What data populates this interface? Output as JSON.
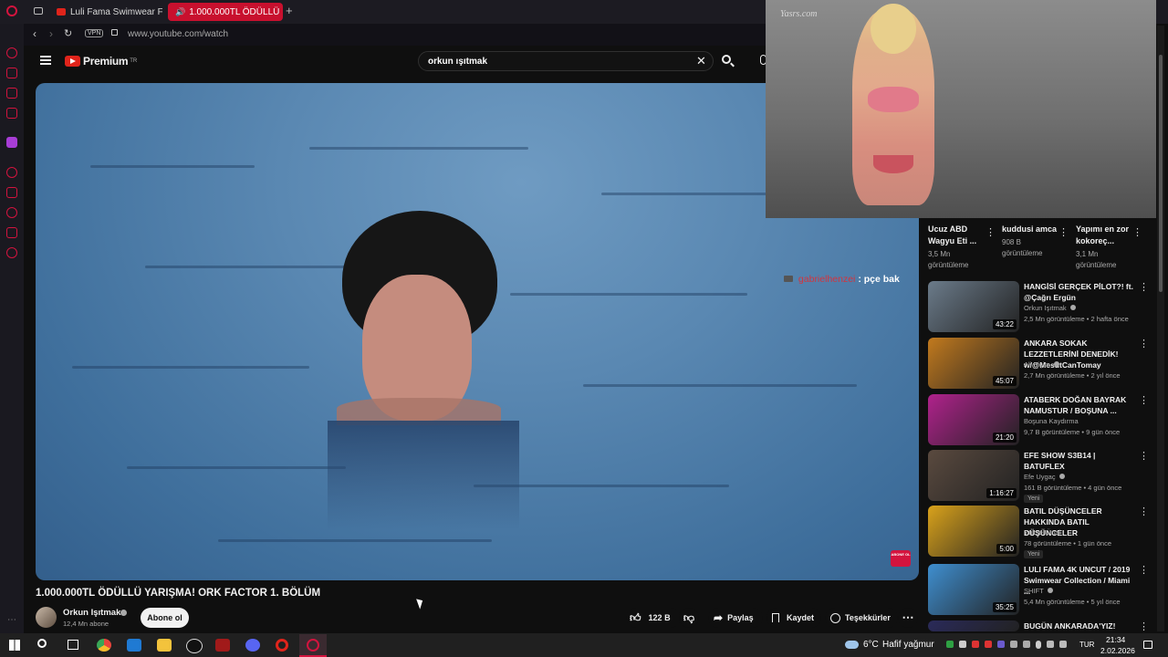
{
  "browser": {
    "tabs": [
      {
        "label": "Luli Fama Swimwear Fash",
        "active": false
      },
      {
        "label": "1.000.000TL ÖDÜLLÜ",
        "active": true
      }
    ],
    "new_tab": "+",
    "address": "www.youtube.com/watch",
    "vpn_label": "VPN"
  },
  "youtube": {
    "brand": "Premium",
    "brand_sup": "TR",
    "search_query": "orkun ışıtmak",
    "video_title": "1.000.000TL ÖDÜLLÜ YARIŞMA! ORK FACTOR 1. BÖLÜM",
    "channel_name": "Orkun Işıtmak",
    "subscribers": "12,4 Mn abone",
    "subscribe_label": "Abone ol",
    "likes": "122 B",
    "share_label": "Paylaş",
    "save_label": "Kaydet",
    "thanks_label": "Teşekkürler",
    "chat_user": "gabrielhenzei",
    "chat_message": ": pçe bak",
    "watermark_label": "ABONE OL",
    "pip_watermark": "Yasrs.com"
  },
  "shorts_row": [
    {
      "title": "Ucuz ABD Wagyu Eti ...",
      "views": "3,5 Mn",
      "views_label": "görüntüleme"
    },
    {
      "title": "kuddusi amca",
      "views": "908 B",
      "views_label": "görüntüleme"
    },
    {
      "title": "Yapımı en zor kokoreç...",
      "views": "3,1 Mn",
      "views_label": "görüntüleme"
    }
  ],
  "related": [
    {
      "title": "HANGİSİ GERÇEK PİLOT?! ft. @Çağrı Ergün",
      "channel": "Orkun Işıtmak",
      "verified": true,
      "meta": "2,5 Mn görüntüleme • 2 hafta önce",
      "duration": "43:22",
      "badge": "",
      "thumb_color": "#6b7b8a"
    },
    {
      "title": "ANKARA SOKAK LEZZETLERİNİ DENEDİK! w/@MesutCanTomay",
      "channel": "Ali Biçim",
      "verified": true,
      "meta": "2,7 Mn görüntüleme • 2 yıl önce",
      "duration": "45:07",
      "badge": "",
      "thumb_color": "#c27a1e"
    },
    {
      "title": "ATABERK DOĞAN BAYRAK NAMUSTUR / BOŞUNA ...",
      "channel": "Boşuna Kaydırma",
      "verified": false,
      "meta": "9,7 B görüntüleme • 9 gün önce",
      "duration": "21:20",
      "badge": "",
      "thumb_color": "#b0228c"
    },
    {
      "title": "EFE SHOW S3B14 | BATUFLEX",
      "channel": "Efe Uygaç",
      "verified": true,
      "meta": "161 B görüntüleme • 4 gün önce",
      "duration": "1:16:27",
      "badge": "Yeni",
      "thumb_color": "#5a4a3f"
    },
    {
      "title": "BATIL DÜŞÜNCELER HAKKINDA BATIL DÜŞÜNCELER",
      "channel": "Yüksel Ünal",
      "verified": false,
      "meta": "78 görüntüleme • 1 gün önce",
      "duration": "5:00",
      "badge": "Yeni",
      "thumb_color": "#d9a21b"
    },
    {
      "title": "LULI FAMA 4K UNCUT / 2019 Swimwear Collection / Miami ...",
      "channel": "SHIFT",
      "verified": true,
      "meta": "5,4 Mn görüntüleme • 5 yıl önce",
      "duration": "35:25",
      "badge": "",
      "thumb_color": "#3f8fd0"
    },
    {
      "title": "BUGÜN ANKARADA'YIZ!",
      "channel": "",
      "verified": false,
      "meta": "",
      "duration": "",
      "badge": "",
      "thumb_color": "#2a2a5a"
    }
  ],
  "taskbar": {
    "weather": "6°C",
    "weather_desc": "Hafif yağmur",
    "lang": "TUR",
    "time": "21:34",
    "date": "2.02.2026"
  },
  "colors": {
    "accent_red": "#e0241b",
    "opera_red": "#d3143e",
    "bg": "#0f0f0f"
  }
}
